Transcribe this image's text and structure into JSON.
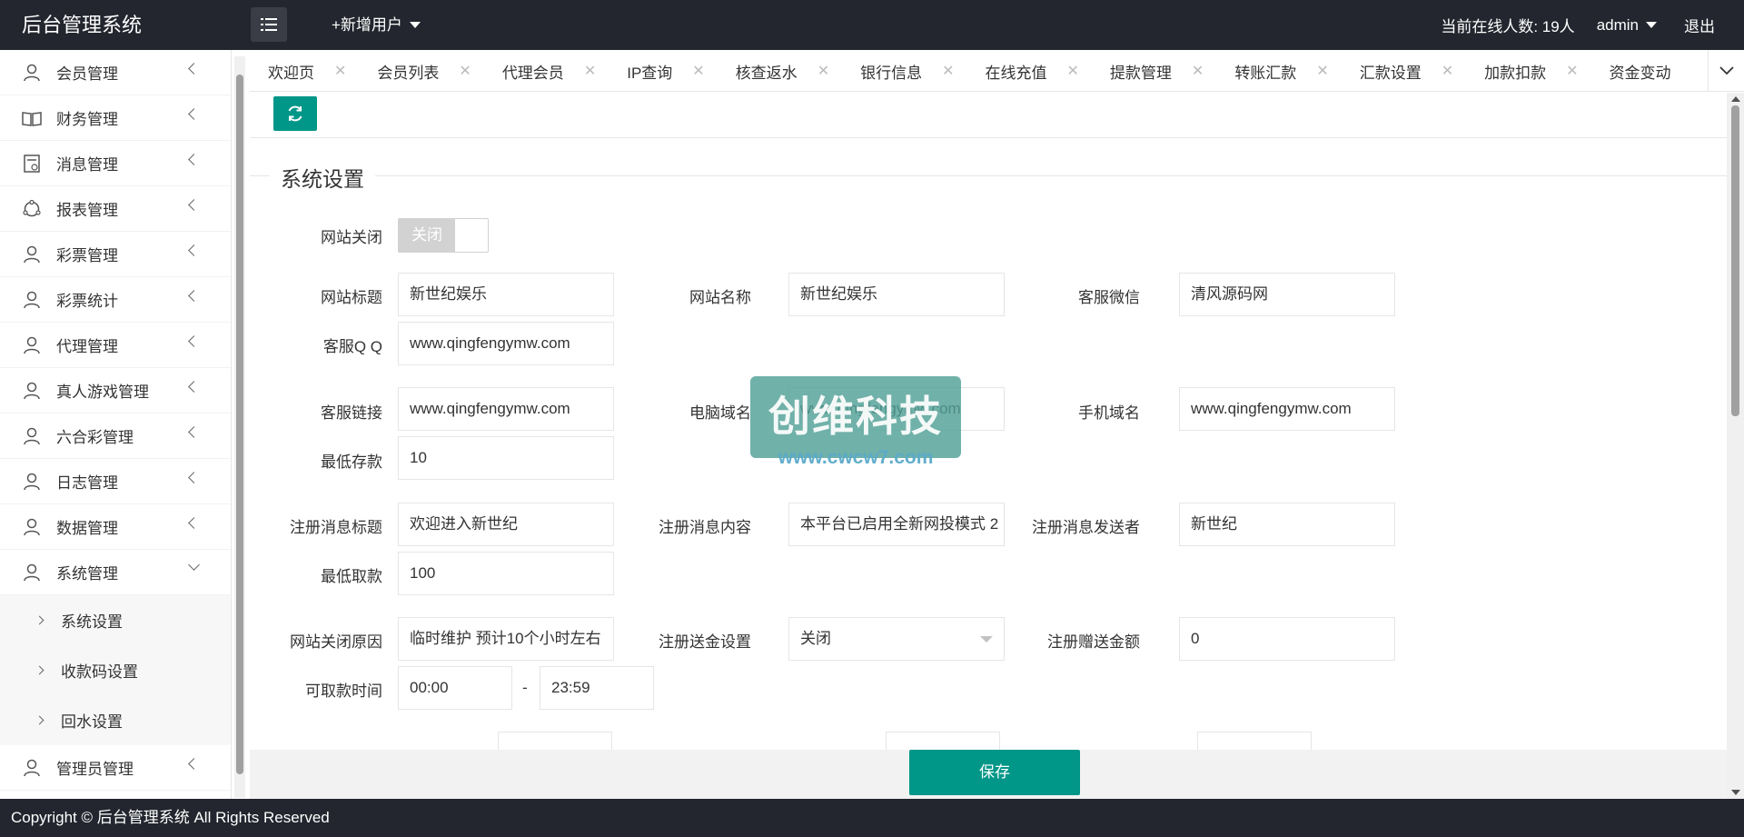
{
  "header": {
    "logo": "后台管理系统",
    "add_user": "+新增用户",
    "online": "当前在线人数: 19人",
    "admin": "admin",
    "logout": "退出"
  },
  "sidebar": {
    "items": [
      {
        "label": "会员管理",
        "icon": "user-icon"
      },
      {
        "label": "财务管理",
        "icon": "book-icon"
      },
      {
        "label": "消息管理",
        "icon": "message-icon"
      },
      {
        "label": "报表管理",
        "icon": "report-icon"
      },
      {
        "label": "彩票管理",
        "icon": "user-icon"
      },
      {
        "label": "彩票统计",
        "icon": "user-icon"
      },
      {
        "label": "代理管理",
        "icon": "user-icon"
      },
      {
        "label": "真人游戏管理",
        "icon": "user-icon"
      },
      {
        "label": "六合彩管理",
        "icon": "user-icon"
      },
      {
        "label": "日志管理",
        "icon": "user-icon"
      },
      {
        "label": "数据管理",
        "icon": "user-icon"
      },
      {
        "label": "系统管理",
        "icon": "user-icon"
      }
    ],
    "sub_items": [
      "系统设置",
      "收款码设置",
      "回水设置"
    ],
    "last_item": {
      "label": "管理员管理",
      "icon": "user-icon"
    }
  },
  "tabs": [
    "欢迎页",
    "会员列表",
    "代理会员",
    "IP查询",
    "核查返水",
    "银行信息",
    "在线充值",
    "提款管理",
    "转账汇款",
    "汇款设置",
    "加款扣款",
    "资金变动"
  ],
  "form": {
    "legend": "系统设置",
    "site_close_label": "网站关闭",
    "site_close_switch": "关闭",
    "site_title_label": "网站标题",
    "site_title_value": "新世纪娱乐",
    "site_name_label": "网站名称",
    "site_name_value": "新世纪娱乐",
    "wechat_label": "客服微信",
    "wechat_value": "清风源码网",
    "qq_label": "客服Q Q",
    "qq_value": "www.qingfengymw.com",
    "link_label": "客服链接",
    "link_value": "www.qingfengymw.com",
    "pc_domain_label": "电脑域名",
    "pc_domain_value": "www.qingfengymw.com",
    "mobile_domain_label": "手机域名",
    "mobile_domain_value": "www.qingfengymw.com",
    "min_deposit_label": "最低存款",
    "min_deposit_value": "10",
    "reg_msg_title_label": "注册消息标题",
    "reg_msg_title_value": "欢迎进入新世纪",
    "reg_msg_content_label": "注册消息内容",
    "reg_msg_content_value": "本平台已启用全新网投模式 2",
    "reg_msg_sender_label": "注册消息发送者",
    "reg_msg_sender_value": "新世纪",
    "min_withdraw_label": "最低取款",
    "min_withdraw_value": "100",
    "close_reason_label": "网站关闭原因",
    "close_reason_value": "临时维护 预计10个小时左右",
    "reg_bonus_setting_label": "注册送金设置",
    "reg_bonus_setting_value": "关闭",
    "reg_bonus_amount_label": "注册赠送金额",
    "reg_bonus_amount_value": "0",
    "withdraw_time_label": "可取款时间",
    "withdraw_time_start": "00:00",
    "withdraw_time_sep": "-",
    "withdraw_time_end": "23:59"
  },
  "save_label": "保存",
  "footer": "Copyright © 后台管理系统 All Rights Reserved",
  "watermark": {
    "text": "创维科技",
    "url": "www.cwcw7.com"
  },
  "colors": {
    "primary": "#009688",
    "header_bg": "#23262e"
  }
}
